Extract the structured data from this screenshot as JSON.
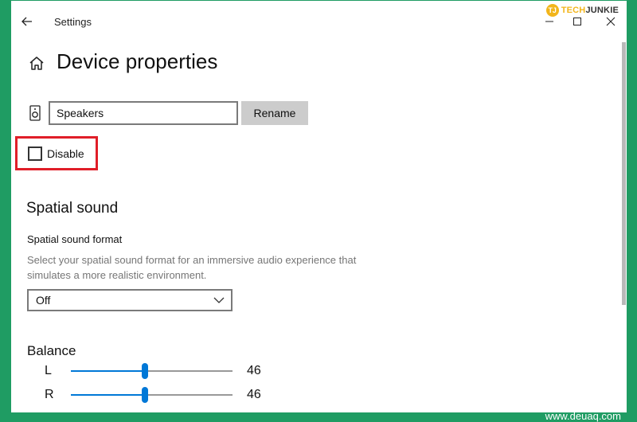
{
  "window": {
    "title": "Settings",
    "logo_text_a": "TECH",
    "logo_text_b": "JUNKIE",
    "logo_badge": "TJ"
  },
  "page": {
    "title": "Device properties"
  },
  "device": {
    "name_value": "Speakers",
    "rename_label": "Rename",
    "disable_label": "Disable",
    "disable_checked": false
  },
  "spatial": {
    "section_title": "Spatial sound",
    "format_label": "Spatial sound format",
    "format_desc": "Select your spatial sound format for an immersive audio experience that simulates a more realistic environment.",
    "format_value": "Off"
  },
  "balance": {
    "title": "Balance",
    "channels": [
      {
        "label": "L",
        "value": "46",
        "level": 0.46
      },
      {
        "label": "R",
        "value": "46",
        "level": 0.46
      }
    ]
  },
  "watermark": "www.deuaq.com",
  "colors": {
    "accent": "#0078d7",
    "frame": "#1f9c63",
    "highlight": "#e01e28"
  },
  "icons": [
    "back-arrow-icon",
    "minimize-icon",
    "maximize-icon",
    "close-icon",
    "home-icon",
    "speaker-icon",
    "chevron-down-icon"
  ]
}
